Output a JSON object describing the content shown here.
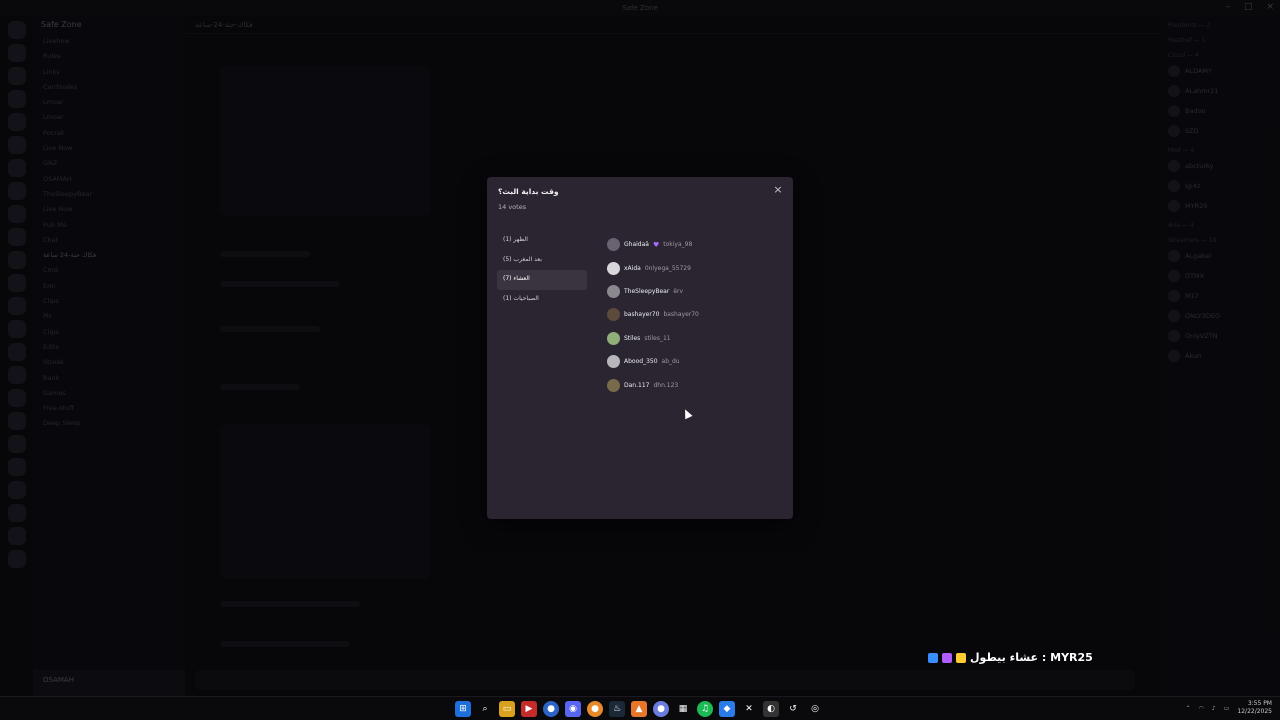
{
  "window": {
    "title": "Safe Zone"
  },
  "server": {
    "name": "Safe Zone"
  },
  "channels": [
    "Livehow",
    "Rules",
    "Links",
    "Cardinales",
    "Lmoar",
    "Lmoar",
    "Pocrak",
    "Live Now",
    "GNZ",
    "OSAMAH",
    "TheSleepyBear",
    "Live Now",
    "Pub Me",
    "Chat",
    "فكاك حنة-24 ساعة",
    "Cmd",
    "Emi",
    "Clips",
    "Pic",
    "Clips",
    "Edits",
    "Streak",
    "Bank",
    "Games",
    "Free-stuff",
    "Deep Sleep"
  ],
  "chat_header": {
    "channel": "فكاك-حنة-24-ساعة"
  },
  "modal": {
    "question": "وقت بداية البث؟",
    "total_votes": "14 votes",
    "close_label": "×",
    "answers": [
      {
        "label": "الظهر (1)"
      },
      {
        "label": "بعد المغرب (5)"
      },
      {
        "label": "العشاء (7)"
      },
      {
        "label": "الصباحيات (1)"
      }
    ],
    "selected_answer_index": 2,
    "voters": [
      {
        "display": "Ghaidaä",
        "username": "tokiya_98",
        "badge": "heart",
        "avatar_color": "#6a6270"
      },
      {
        "display": "xAida",
        "username": "0nlyega_55729",
        "avatar_color": "#d8d6da"
      },
      {
        "display": "TheSleepyBear",
        "username": "ёrv",
        "avatar_color": "#8c8890"
      },
      {
        "display": "bashayer70",
        "username": "bashayer70",
        "avatar_color": "#5c4a3a"
      },
      {
        "display": "Stiles",
        "username": "stiles_11",
        "avatar_color": "#8fae7a"
      },
      {
        "display": "Abood_350",
        "username": "ab_du",
        "avatar_color": "#b8b6bc"
      },
      {
        "display": "Dan.117",
        "username": "dhn.123",
        "avatar_color": "#7a6a4c"
      }
    ]
  },
  "user_panel": {
    "name": "OSAMAH"
  },
  "stream_overlay": {
    "text": "عشاء بيطول : MYR25",
    "icon_colors": [
      "#3a8dff",
      "#b05cff",
      "#ffcc33"
    ]
  },
  "members": [
    "Prerdents — 2",
    "Heathef — 1",
    "Cloud — 4",
    "ALDAMY",
    "ALahmr21",
    "Badoo",
    "SZD",
    "Mod — 4",
    "abcturky",
    "Igi4z",
    "MYR25",
    "Aria — 4",
    "Streamers — 10",
    "ALgabel",
    "DTMX",
    "M17",
    "ONLY3DEO",
    "OnlyVZTN",
    "Akun"
  ],
  "taskbar": {
    "time": "3:55 PM",
    "date": "12/22/2025"
  }
}
